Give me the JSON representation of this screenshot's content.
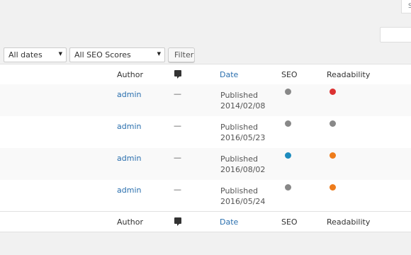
{
  "screen_options_label": "S",
  "filters": {
    "dates_label": "All dates",
    "seo_label": "All SEO Scores",
    "filter_button": "Filter"
  },
  "columns": {
    "author": "Author",
    "date": "Date",
    "seo": "SEO",
    "readability": "Readability"
  },
  "rows": [
    {
      "author": "admin",
      "comments": "—",
      "status": "Published",
      "date": "2014/02/08",
      "seo_color": "#888888",
      "readability_color": "#dc3232"
    },
    {
      "author": "admin",
      "comments": "—",
      "status": "Published",
      "date": "2016/05/23",
      "seo_color": "#888888",
      "readability_color": "#888888"
    },
    {
      "author": "admin",
      "comments": "—",
      "status": "Published",
      "date": "2016/08/02",
      "seo_color": "#1e8cbe",
      "readability_color": "#ee7c1b"
    },
    {
      "author": "admin",
      "comments": "—",
      "status": "Published",
      "date": "2016/05/24",
      "seo_color": "#888888",
      "readability_color": "#ee7c1b"
    }
  ],
  "colors": {
    "link": "#2a6fae",
    "gray": "#888888",
    "red": "#dc3232",
    "orange": "#ee7c1b",
    "blue": "#1e8cbe"
  },
  "icons": {
    "comments": "comment-bubble-icon",
    "dropdown": "chevron-down-icon"
  }
}
